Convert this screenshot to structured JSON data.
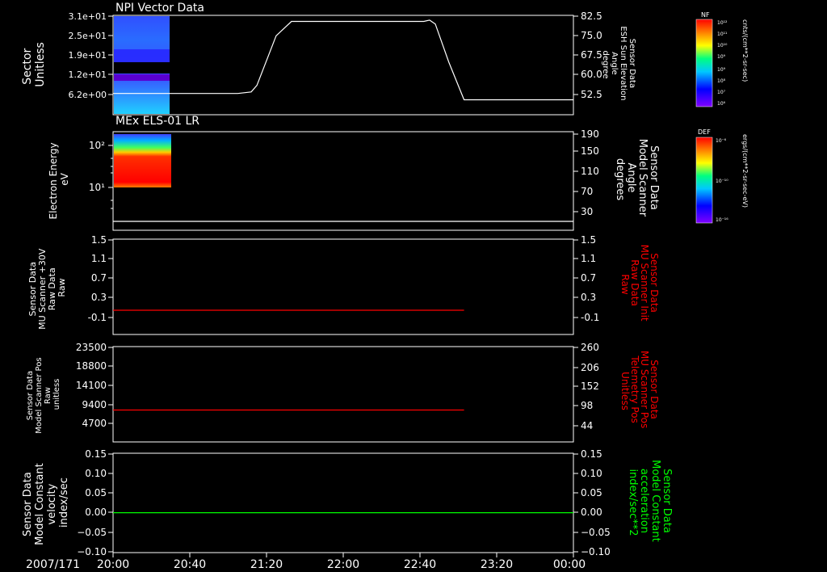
{
  "date_label": "2007/171",
  "x_ticks": [
    "20:00",
    "20:40",
    "21:20",
    "22:00",
    "22:40",
    "23:20",
    "00:00"
  ],
  "colors": {
    "background": "#000000",
    "frame": "#ffffff",
    "red": "#ff0000",
    "green": "#00ff00"
  },
  "colorbars": [
    {
      "label": "NF",
      "units": "cnts/(cm**2-sr-sec)",
      "ticks": [
        "10⁹",
        "10¹⁰",
        "10¹¹",
        "10¹²",
        "10⁹",
        "10⁸",
        "10⁷",
        "10⁶"
      ]
    },
    {
      "label": "DEF",
      "units": "ergs/(cm**2-sr-sec-eV)",
      "ticks": [
        "10⁻⁶",
        "10⁻¹⁰",
        "10⁻¹⁶"
      ]
    }
  ],
  "chart_data": [
    {
      "type": "line",
      "title": "NPI Vector Data",
      "left_axis": {
        "label": [
          "Sector",
          "Unitless"
        ],
        "ticks": [
          "3.1e+01",
          "2.5e+01",
          "1.9e+01",
          "1.2e+01",
          "6.2e+00"
        ]
      },
      "right_axis": {
        "label": [
          "Sensor Data",
          "ESH Sun Elevation",
          "Angle",
          "degree"
        ],
        "ticks": [
          "82.5",
          "75.0",
          "67.5",
          "60.0",
          "52.5"
        ],
        "ylim": [
          47,
          85
        ]
      },
      "spectrogram": {
        "x_start": "20:00",
        "x_end": "20:35",
        "colorbar": "NF"
      },
      "series": [
        {
          "color": "#ffffff",
          "x": [
            "20:00",
            "21:05",
            "21:12",
            "21:15",
            "21:25",
            "21:33",
            "22:42",
            "22:45",
            "22:48",
            "22:55",
            "23:03",
            "00:00"
          ],
          "y": [
            52.9,
            52.9,
            53.5,
            56,
            75,
            80.5,
            80.5,
            81,
            79.5,
            65,
            50.5,
            50.5
          ]
        }
      ]
    },
    {
      "type": "line",
      "title": "MEx ELS-01 LR",
      "left_axis": {
        "label": [
          "Electron Energy",
          "eV"
        ],
        "ticks": [
          "10²",
          "10¹"
        ],
        "scale": "log"
      },
      "right_axis": {
        "label": [
          "Sensor Data",
          "Model Scanner",
          "Angle",
          "degrees"
        ],
        "ticks": [
          "190",
          "150",
          "110",
          "70",
          "30"
        ],
        "ylim": [
          0,
          190
        ]
      },
      "spectrogram": {
        "x_start": "20:00",
        "x_end": "20:37",
        "colorbar": "DEF"
      },
      "series": [
        {
          "color": "#ffffff",
          "x": [
            "20:00",
            "00:00"
          ],
          "y": [
            10,
            10
          ]
        }
      ]
    },
    {
      "type": "line",
      "left_axis": {
        "label": [
          "Sensor Data",
          "MU Scanner +30V",
          "Raw Data",
          "Raw"
        ],
        "ticks": [
          "1.5",
          "1.1",
          "0.7",
          "0.3",
          "-0.1"
        ],
        "ylim": [
          -0.4,
          1.5
        ]
      },
      "right_axis": {
        "label": [
          "Sensor Data",
          "MU Scanner Init",
          "Raw Data",
          "Raw"
        ],
        "ticks": [
          "1.5",
          "1.1",
          "0.7",
          "0.3",
          "-0.1"
        ],
        "ylim": [
          -0.4,
          1.5
        ],
        "color": "#ff0000"
      },
      "series": [
        {
          "color": "#ff0000",
          "x": [
            "20:00",
            "23:03"
          ],
          "y": [
            0.05,
            0.05
          ]
        }
      ]
    },
    {
      "type": "line",
      "left_axis": {
        "label": [
          "Sensor Data",
          "Model Scanner Pos",
          "Raw",
          "unitless"
        ],
        "ticks": [
          "23500",
          "18800",
          "14100",
          "9400",
          "4700"
        ],
        "ylim": [
          0,
          23500
        ]
      },
      "right_axis": {
        "label": [
          "Sensor Data",
          "MU Scanner Pos",
          "Telemetry Pos",
          "Unitless"
        ],
        "ticks": [
          "260",
          "206",
          "152",
          "98",
          "44"
        ],
        "ylim": [
          0,
          260
        ],
        "color": "#ff0000"
      },
      "series": [
        {
          "color": "#ff0000",
          "x": [
            "20:00",
            "23:03"
          ],
          "y": [
            8000,
            8000
          ]
        }
      ]
    },
    {
      "type": "line",
      "left_axis": {
        "label": [
          "Sensor Data",
          "Model Constant",
          "velocity",
          "index/sec"
        ],
        "ticks": [
          "0.15",
          "0.10",
          "0.05",
          "0.00",
          "−0.05",
          "−0.10"
        ],
        "ylim": [
          -0.1,
          0.15
        ]
      },
      "right_axis": {
        "label": [
          "Sensor Data",
          "Model Constant",
          "acceleration",
          "index/sec**2"
        ],
        "ticks": [
          "0.15",
          "0.10",
          "0.05",
          "0.00",
          "−0.05",
          "−0.10"
        ],
        "ylim": [
          -0.1,
          0.15
        ],
        "color": "#00ff00"
      },
      "series": [
        {
          "color": "#00ff00",
          "x": [
            "20:00",
            "00:00"
          ],
          "y": [
            0,
            0
          ]
        }
      ]
    }
  ]
}
